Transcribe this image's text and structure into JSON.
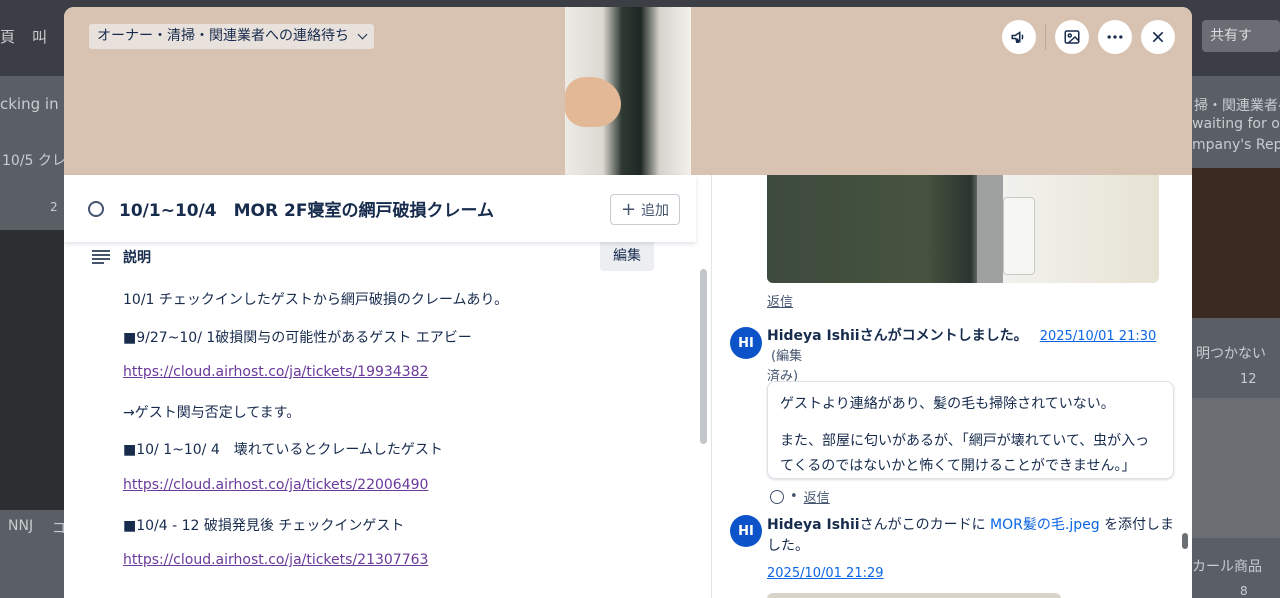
{
  "background": {
    "left_top_fragment": "頁",
    "left_top_fragment2": "叫",
    "left_card_title": "cking in Pa",
    "left_card_sub": "10/5 クレ",
    "left_card_count": "2",
    "left_bottom": "NNJ",
    "left_bottom2": "コ",
    "right_share": "共有す",
    "right_card_line1": "掃・関連業者へ",
    "right_card_line2": "waiting for ov",
    "right_card_line3": "mpany's Rep",
    "right_card2_title": "明つかない",
    "right_card2_count": "12",
    "right_card3_title": "カール商品",
    "right_card3_count": "8"
  },
  "header": {
    "list_name": "オーナー・清掃・関連業者への連絡待ち",
    "icons": [
      "megaphone-icon",
      "image-icon",
      "more-icon",
      "close-icon"
    ]
  },
  "card": {
    "title": "10/1~10/4　MOR 2F寝室の網戸破損クレーム",
    "add_label": "追加"
  },
  "description": {
    "label": "説明",
    "edit_label": "編集",
    "lines": [
      "10/1 チェックインしたゲストから網戸破損のクレームあり。",
      "■9/27~10/ 1破損関与の可能性があるゲスト エアビー",
      "https://cloud.airhost.co/ja/tickets/19934382",
      "→ゲスト関与否定してます。",
      "■10/ 1~10/ 4　壊れているとクレームしたゲスト",
      "https://cloud.airhost.co/ja/tickets/22006490",
      "■10/4 - 12 破損発見後 チェックインゲスト",
      "https://cloud.airhost.co/ja/tickets/21307763"
    ]
  },
  "activity": {
    "reply_label": "返信",
    "comment": {
      "avatar": "HI",
      "author_line": "Hideya Ishiiさんがコメントしました。",
      "timestamp": "2025/10/01 21:30",
      "edited": "(編集",
      "edited2": "済み)",
      "text1": "ゲストより連絡があり、髪の毛も掃除されていない。",
      "text2": "また、部屋に匂いがあるが、「網戸が壊れていて、虫が入ってくるのではないかと怖くて開けることができません。」",
      "reply_label": "返信"
    },
    "attachment": {
      "avatar": "HI",
      "author": "Hideya Ishii",
      "action": "さんがこのカードに",
      "file": "MOR髪の毛.jpeg",
      "action2": "を添付しました。",
      "timestamp": "2025/10/01 21:29"
    }
  }
}
